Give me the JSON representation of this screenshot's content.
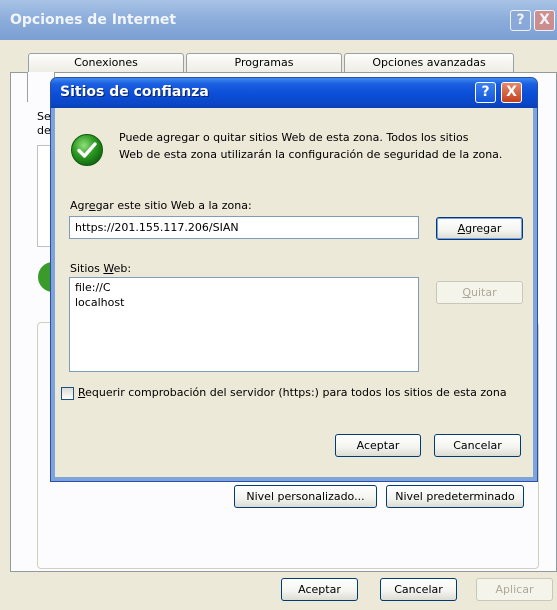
{
  "parent_dialog": {
    "title": "Opciones de Internet",
    "help_glyph": "?",
    "close_glyph": "X",
    "tabs": [
      "Conexiones",
      "Programas",
      "Opciones avanzadas"
    ],
    "hidden_text_1": "Se",
    "hidden_text_2": "de",
    "buttons": {
      "nivel_personalizado": "Nivel personalizado...",
      "nivel_predeterminado": "Nivel predeterminado",
      "aceptar": "Aceptar",
      "cancelar": "Cancelar",
      "aplicar": "Aplicar"
    }
  },
  "dialog": {
    "title": "Sitios de confianza",
    "help_glyph": "?",
    "close_glyph": "X",
    "info_line1": "Puede agregar o quitar sitios Web de esta zona.  Todos los sitios",
    "info_line2": "Web de esta zona utilizarán la configuración de seguridad de la zona.",
    "add_label_pre": "Agr",
    "add_label_acc": "e",
    "add_label_post": "gar este sitio Web a la zona:",
    "add_value": "https://201.155.117.206/SIAN",
    "add_button_acc": "A",
    "add_button_post": "gregar",
    "sites_label_pre": "Sitios ",
    "sites_label_acc": "W",
    "sites_label_post": "eb:",
    "sites": [
      "file://C",
      "localhost"
    ],
    "remove_button_acc": "Q",
    "remove_button_post": "uitar",
    "require_acc": "R",
    "require_post": "equerir comprobación del servidor (https:) para todos los sitios de esta zona",
    "require_checked": false,
    "ok_label": "Aceptar",
    "cancel_label": "Cancelar"
  },
  "icons": {
    "info": "green-check-shield-icon"
  }
}
